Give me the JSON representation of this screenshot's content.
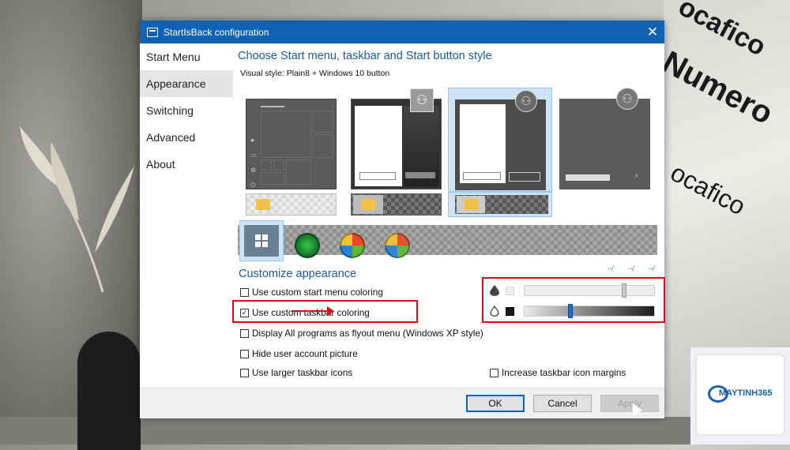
{
  "window": {
    "title": "StartIsBack configuration",
    "close_glyph": "✕"
  },
  "sidebar": {
    "items": [
      {
        "label": "Start Menu"
      },
      {
        "label": "Appearance",
        "active": true
      },
      {
        "label": "Switching"
      },
      {
        "label": "Advanced"
      },
      {
        "label": "About"
      }
    ]
  },
  "appearance": {
    "section_title": "Choose Start menu, taskbar and Start button style",
    "visual_style": "Visual style:  Plain8 + Windows 10 button",
    "customize_title": "Customize appearance",
    "checkboxes": [
      {
        "label": "Use custom start menu coloring",
        "checked": false
      },
      {
        "label": "Use custom taskbar coloring",
        "checked": true
      },
      {
        "label": "Display All programs as flyout menu (Windows XP style)",
        "checked": false
      },
      {
        "label": "Hide user account picture",
        "checked": false
      },
      {
        "label": "Use larger taskbar icons",
        "checked": false
      },
      {
        "label": "Increase taskbar icon margins",
        "checked": false
      }
    ],
    "check_glyph": "✓",
    "sliders": [
      {
        "icon": "drop-filled-icon",
        "swatch_color": "#eeeeee",
        "level": 0.78
      },
      {
        "icon": "drop-outline-icon",
        "swatch_color": "#1b1b1b",
        "level": 0.35
      }
    ],
    "accent_color": "#1d5a9f",
    "highlight_color": "#d4101a"
  },
  "footer": {
    "ok_label": "OK",
    "cancel_label": "Cancel",
    "apply_label": "Apply"
  },
  "background": {
    "book_text_1": "ocafico",
    "book_text_2": "Numero",
    "book_text_3": "ocafico",
    "logo_text": "MAYTINH365"
  }
}
